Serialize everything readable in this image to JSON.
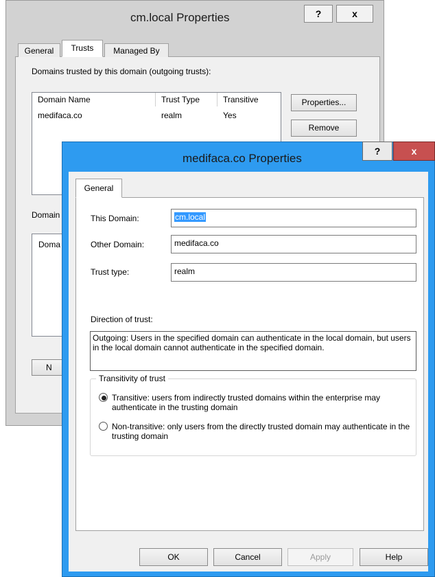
{
  "back_window": {
    "title": "cm.local Properties",
    "help_glyph": "?",
    "close_glyph": "x",
    "tabs": [
      {
        "label": "General",
        "active": false
      },
      {
        "label": "Trusts",
        "active": true
      },
      {
        "label": "Managed By",
        "active": false
      }
    ],
    "outgoing_label": "Domains trusted by this domain (outgoing trusts):",
    "columns": [
      "Domain Name",
      "Trust Type",
      "Transitive"
    ],
    "rows": [
      {
        "domain": "medifaca.co",
        "type": "realm",
        "transitive": "Yes"
      }
    ],
    "properties_button": "Properties...",
    "remove_button": "Remove",
    "incoming_label_fragment": "Domain",
    "incoming_column_fragment": "Doma",
    "new_button_fragment": "N"
  },
  "front_window": {
    "title": "medifaca.co Properties",
    "help_glyph": "?",
    "close_glyph": "x",
    "tab": "General",
    "this_domain_label": "This Domain:",
    "this_domain_value": "cm.local",
    "other_domain_label": "Other Domain:",
    "other_domain_value": "medifaca.co",
    "trust_type_label": "Trust type:",
    "trust_type_value": "realm",
    "direction_label": "Direction of trust:",
    "direction_text": "Outgoing: Users in the specified domain can authenticate in the local domain, but users in the local domain cannot authenticate in the specified domain.",
    "transitivity_legend": "Transitivity of trust",
    "transitive_option": "Transitive: users from indirectly trusted domains within the enterprise may authenticate in the trusting domain",
    "nontransitive_option": "Non-transitive: only users from the directly trusted domain may authenticate in the trusting domain",
    "selected_option": "transitive",
    "buttons": {
      "ok": "OK",
      "cancel": "Cancel",
      "apply": "Apply",
      "help": "Help"
    }
  },
  "colors": {
    "front_border": "#2e9bf0",
    "close_button": "#c75050",
    "selection": "#3399ff"
  }
}
